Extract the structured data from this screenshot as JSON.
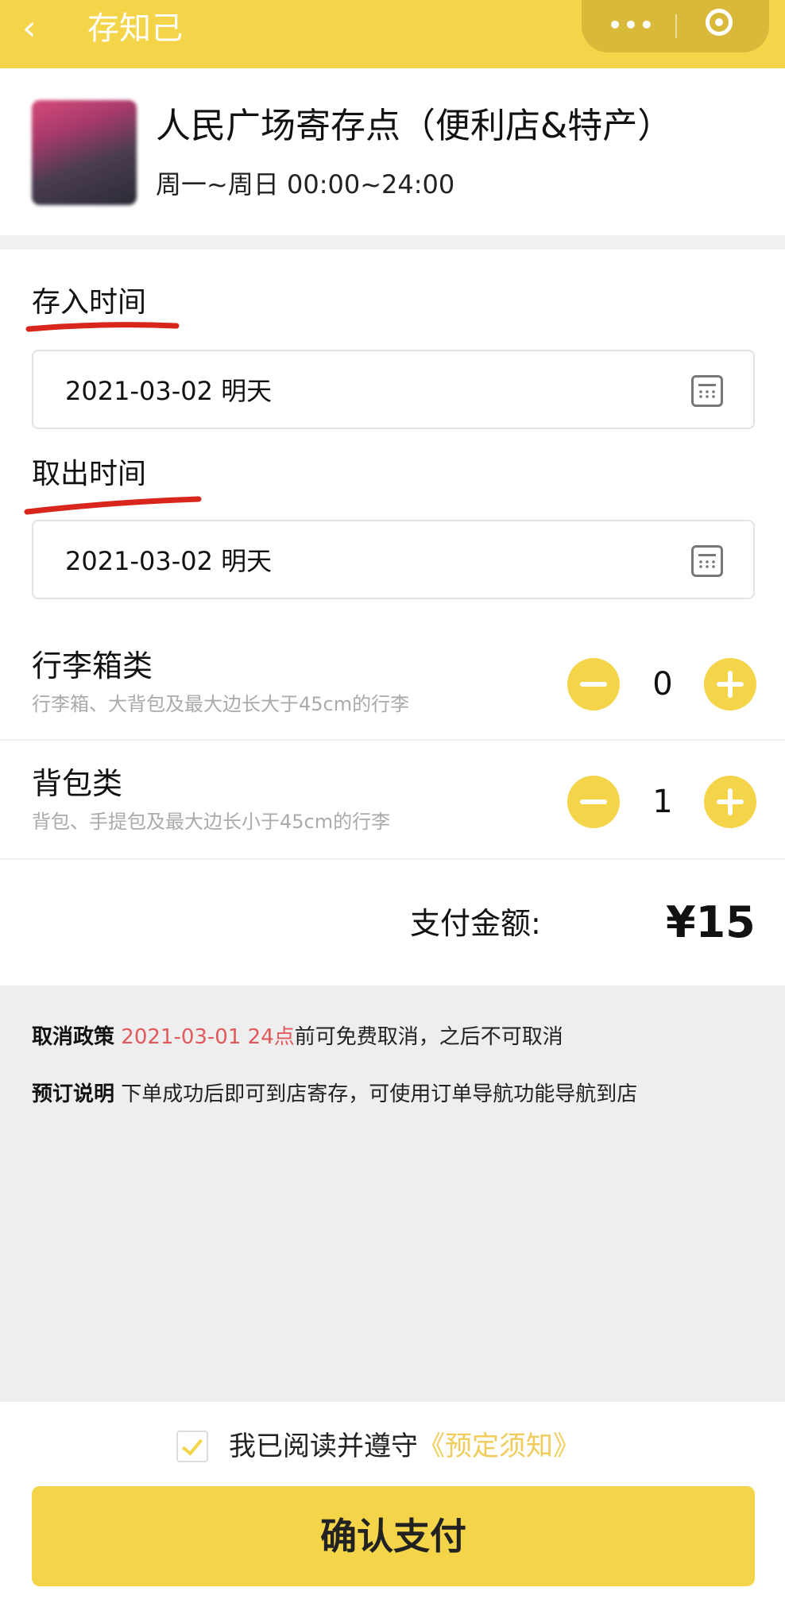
{
  "header": {
    "back_label": "‹",
    "title": "存知己",
    "menu_dots": "•••"
  },
  "store": {
    "name": "人民广场寄存点（便利店&特产）",
    "hours": "周一~周日 00:00~24:00"
  },
  "deposit": {
    "label": "存入时间",
    "value": "2021-03-02 明天"
  },
  "pickup": {
    "label": "取出时间",
    "value": "2021-03-02 明天"
  },
  "items": [
    {
      "title": "行李箱类",
      "desc": "行李箱、大背包及最大边长大于45cm的行李",
      "count": "0"
    },
    {
      "title": "背包类",
      "desc": "背包、手提包及最大边长小于45cm的行李",
      "count": "1"
    }
  ],
  "payment": {
    "label": "支付金额:",
    "amount": "¥15"
  },
  "policy": {
    "cancel_key": "取消政策",
    "cancel_date": "2021-03-01 24点",
    "cancel_text": "前可免费取消，之后不可取消",
    "booking_key": "预订说明",
    "booking_text": "下单成功后即可到店寄存，可使用订单导航功能导航到店"
  },
  "agreement": {
    "text": "我已阅读并遵守",
    "link": "《预定须知》"
  },
  "confirm_button": "确认支付",
  "colors": {
    "brand_yellow": "#f4d449",
    "accent_red": "#e0595c",
    "annotation_red": "#d8261c"
  }
}
